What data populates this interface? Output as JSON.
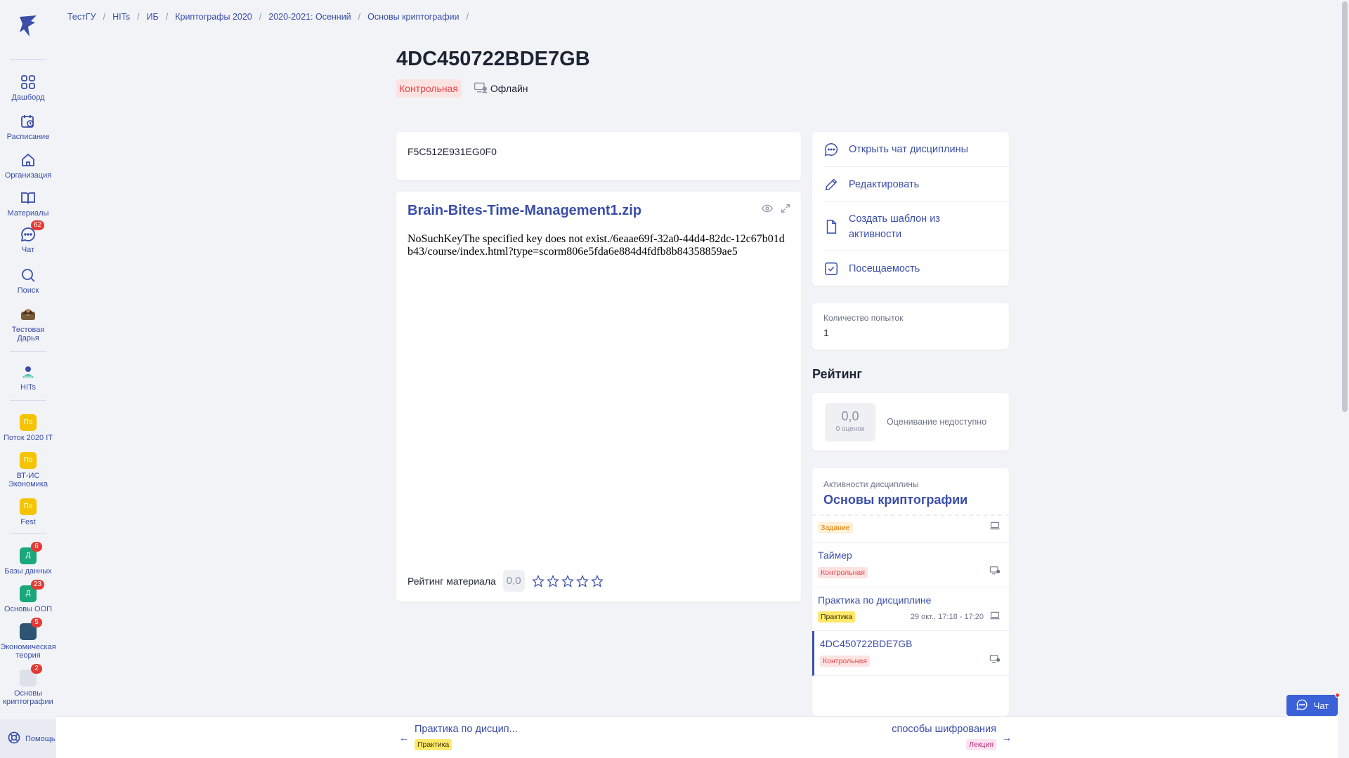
{
  "breadcrumb": [
    "ТестГУ",
    "HITs",
    "ИБ",
    "Криптографы 2020",
    "2020-2021: Осенний",
    "Основы криптографии"
  ],
  "sidebar": {
    "items": [
      {
        "label": "Дашборд",
        "icon": "dashboard-icon"
      },
      {
        "label": "Расписание",
        "icon": "schedule-icon"
      },
      {
        "label": "Организация",
        "icon": "home-icon"
      },
      {
        "label": "Материалы",
        "icon": "book-icon"
      },
      {
        "label": "Чат",
        "icon": "chat-icon",
        "badge": "62"
      },
      {
        "label": "Поиск",
        "icon": "search-icon"
      },
      {
        "label": "Тестовая Дарья",
        "icon": "avatar"
      },
      {
        "label": "HITs",
        "icon": "org-avatar"
      }
    ],
    "courses": [
      {
        "label": "Поток 2020 IT",
        "initials": "По",
        "color": "#f5c400"
      },
      {
        "label": "ВТ-ИС Экономика",
        "initials": "По",
        "color": "#f5c400"
      },
      {
        "label": "Fest",
        "initials": "По",
        "color": "#f5c400"
      },
      {
        "label": "Базы данных",
        "initials": "Д",
        "color": "#1aa77a",
        "badge": "6"
      },
      {
        "label": "Основы ООП",
        "initials": "Д",
        "color": "#1aa77a",
        "badge": "23"
      },
      {
        "label": "Экономическая теория",
        "initials": "",
        "color": "#2d5472",
        "badge": "5"
      },
      {
        "label": "Основы криптографии",
        "initials": "",
        "color": "#8a93a6",
        "badge": "2"
      }
    ],
    "help_label": "Помощь"
  },
  "header": {
    "title": "4DC450722BDE7GB",
    "type_tag": "Контрольная",
    "mode": "Офлайн"
  },
  "main": {
    "description": "F5C512E931EG0F0",
    "file_title": "Brain-Bites-Time-Management1.zip",
    "error_text": "NoSuchKeyThe specified key does not exist./6eaae69f-32a0-44d4-82dc-12c67b01db43/course/index.html?type=scorm806e5fda6e884d4fdfb8b84358859ae5",
    "rating_label": "Рейтинг материала",
    "rating_value": "0,0",
    "stars": 0
  },
  "actions": [
    {
      "label": "Открыть чат дисциплины",
      "icon": "chat-bubble-icon"
    },
    {
      "label": "Редактировать",
      "icon": "pencil-icon"
    },
    {
      "label": "Создать шаблон из активности",
      "icon": "file-icon"
    },
    {
      "label": "Посещаемость",
      "icon": "checkbox-icon"
    }
  ],
  "attempts": {
    "label": "Количество попыток",
    "value": "1"
  },
  "rating": {
    "heading": "Рейтинг",
    "value": "0,0",
    "count": "0 оценок",
    "note": "Оценивание недоступно"
  },
  "discipline": {
    "label": "Активности дисциплины",
    "name": "Основы криптографии",
    "items": [
      {
        "title": "",
        "tag": "Задание",
        "tag_color": "orange",
        "time": ""
      },
      {
        "title": "Таймер",
        "tag": "Контрольная",
        "tag_color": "red",
        "time": ""
      },
      {
        "title": "Практика по дисциплине",
        "tag": "Практика",
        "tag_color": "yellow",
        "time": "29 окт., 17:18 - 17:20"
      },
      {
        "title": "4DC450722BDE7GB",
        "tag": "Контрольная",
        "tag_color": "red",
        "time": ""
      }
    ]
  },
  "nav": {
    "prev_title": "Практика по дисцип...",
    "prev_tag": "Практика",
    "next_title": "способы шифрования",
    "next_tag": "Лекция"
  },
  "chat_button": "Чат"
}
